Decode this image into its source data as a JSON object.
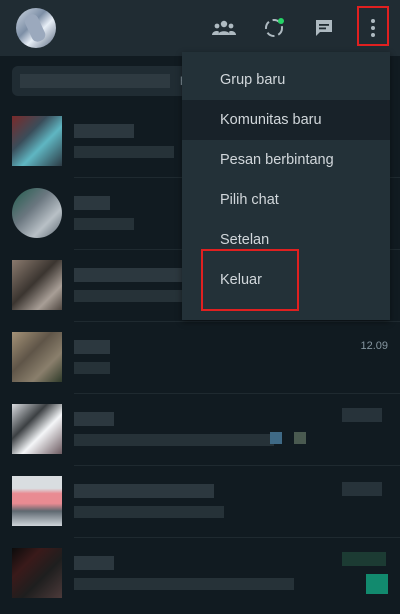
{
  "header": {
    "icons": [
      "community-icon",
      "status-icon",
      "new-chat-icon",
      "menu-icon"
    ]
  },
  "search": {
    "fragment": "ha"
  },
  "chats": [
    {
      "time": ""
    },
    {
      "time": ""
    },
    {
      "time": ""
    },
    {
      "time": "12.09"
    },
    {
      "time": ""
    },
    {
      "time": ""
    },
    {
      "time": ""
    }
  ],
  "menu": {
    "items": [
      {
        "label": "Grup baru"
      },
      {
        "label": "Komunitas baru"
      },
      {
        "label": "Pesan berbintang"
      },
      {
        "label": "Pilih chat"
      },
      {
        "label": "Setelan"
      },
      {
        "label": "Keluar"
      }
    ]
  },
  "colors": {
    "header_bg": "#202c33",
    "page_bg": "#111b21",
    "menu_bg": "#233138",
    "highlight_box": "#e02020",
    "status_dot": "#25d366"
  }
}
